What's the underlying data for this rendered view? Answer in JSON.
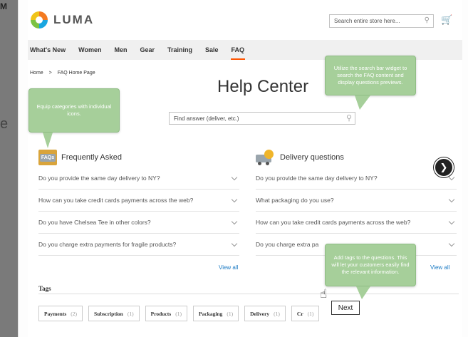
{
  "store": {
    "logo_text": "LUMA",
    "search_placeholder": "Search entire store here...",
    "brand_colors": [
      "#f47a20",
      "#1aa6e0",
      "#7cc242",
      "#f0c419"
    ],
    "accent_color": "#ff5501"
  },
  "nav": {
    "items": [
      "What's New",
      "Women",
      "Men",
      "Gear",
      "Training",
      "Sale",
      "FAQ"
    ],
    "active": "FAQ"
  },
  "breadcrumb": {
    "home": "Home",
    "current": "FAQ Home Page"
  },
  "page_title": "Help Center",
  "faq_search": {
    "placeholder": "Find answer (deliver, etc.)"
  },
  "sections": [
    {
      "icon_label": "FAQs",
      "title": "Frequently Asked",
      "questions": [
        "Do you provide the same day delivery to NY?",
        "How can you take credit cards payments across the web?",
        "Do you have Chelsea Tee in other colors?",
        "Do you charge extra payments for fragile products?"
      ],
      "view_all": "View all"
    },
    {
      "title": "Delivery questions",
      "questions": [
        "Do you provide the same day delivery to NY?",
        "What packaging do you use?",
        "How can you take credit cards payments across the web?",
        "Do you charge extra pa"
      ],
      "view_all": "View all"
    }
  ],
  "tags": {
    "title": "Tags",
    "items": [
      {
        "name": "Payments",
        "count": "(2)"
      },
      {
        "name": "Subscription",
        "count": "(1)"
      },
      {
        "name": "Products",
        "count": "(1)"
      },
      {
        "name": "Packaging",
        "count": "(1)"
      },
      {
        "name": "Delivery",
        "count": "(1)"
      },
      {
        "name": "Cr",
        "count": "(1)"
      }
    ]
  },
  "tooltips": {
    "categories": "Equip categories with individual icons.",
    "search": "Utilize the search bar widget to search the FAQ content and display questions previews.",
    "tags": "Add tags to the questions. This will let your customers easily find the relevant information.",
    "color": "#a6cf9a"
  },
  "tour": {
    "next_label": "Next"
  }
}
